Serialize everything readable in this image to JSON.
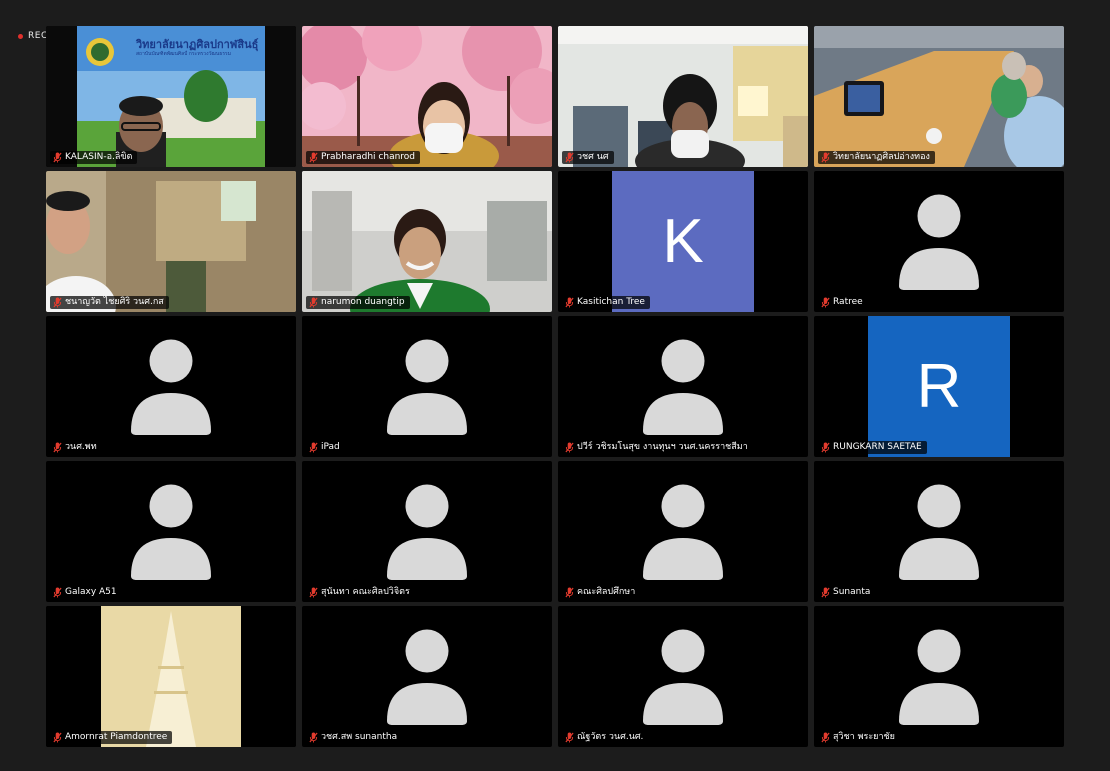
{
  "recording": {
    "label": "REC"
  },
  "colors": {
    "tile_bg": "#000000",
    "avatar": "#d9d9d9",
    "muted_mic": "#e33b2e",
    "letter_k": "#5c6bc0",
    "letter_r": "#1565c0"
  },
  "participants": [
    {
      "name": "KALASIN-อ.ลิขิต",
      "kind": "video"
    },
    {
      "name": "Prabharadhi chanrod",
      "kind": "video"
    },
    {
      "name": "วชศ นศ",
      "kind": "video"
    },
    {
      "name": "วิทยาลัยนาฏศิลปอ่างทอง",
      "kind": "video"
    },
    {
      "name": "ชนาญวัต ไชยศิริ วนศ.กส",
      "kind": "video"
    },
    {
      "name": "narumon duangtip",
      "kind": "video"
    },
    {
      "name": "Kasitichan Tree",
      "kind": "letter",
      "letter": "K"
    },
    {
      "name": "Ratree",
      "kind": "avatar"
    },
    {
      "name": "วนศ.พท",
      "kind": "avatar"
    },
    {
      "name": "iPad",
      "kind": "avatar"
    },
    {
      "name": "ปวีร์ วชิรมโนสุข งานทุนฯ วนศ.นครราชสีมา",
      "kind": "avatar"
    },
    {
      "name": "RUNGKARN SAETAE",
      "kind": "letter",
      "letter": "R"
    },
    {
      "name": "Galaxy A51",
      "kind": "avatar"
    },
    {
      "name": "สุนันทา คณะศิลปวิจิตร",
      "kind": "avatar"
    },
    {
      "name": "คณะศิลปศึกษา",
      "kind": "avatar"
    },
    {
      "name": "Sunanta",
      "kind": "avatar"
    },
    {
      "name": "Amornrat Piamdontree",
      "kind": "video"
    },
    {
      "name": "วชศ.สพ sunantha",
      "kind": "avatar"
    },
    {
      "name": "ณัฐวัตร วนศ.นศ.",
      "kind": "avatar"
    },
    {
      "name": "สุวิชา พระยาชัย",
      "kind": "avatar"
    }
  ],
  "banner": {
    "title": "วิทยาลัยนาฏศิลปกาฬสินธุ์",
    "subtitle": "สถาบันบัณฑิตพัฒนศิลป์ กระทรวงวัฒนธรรม"
  }
}
